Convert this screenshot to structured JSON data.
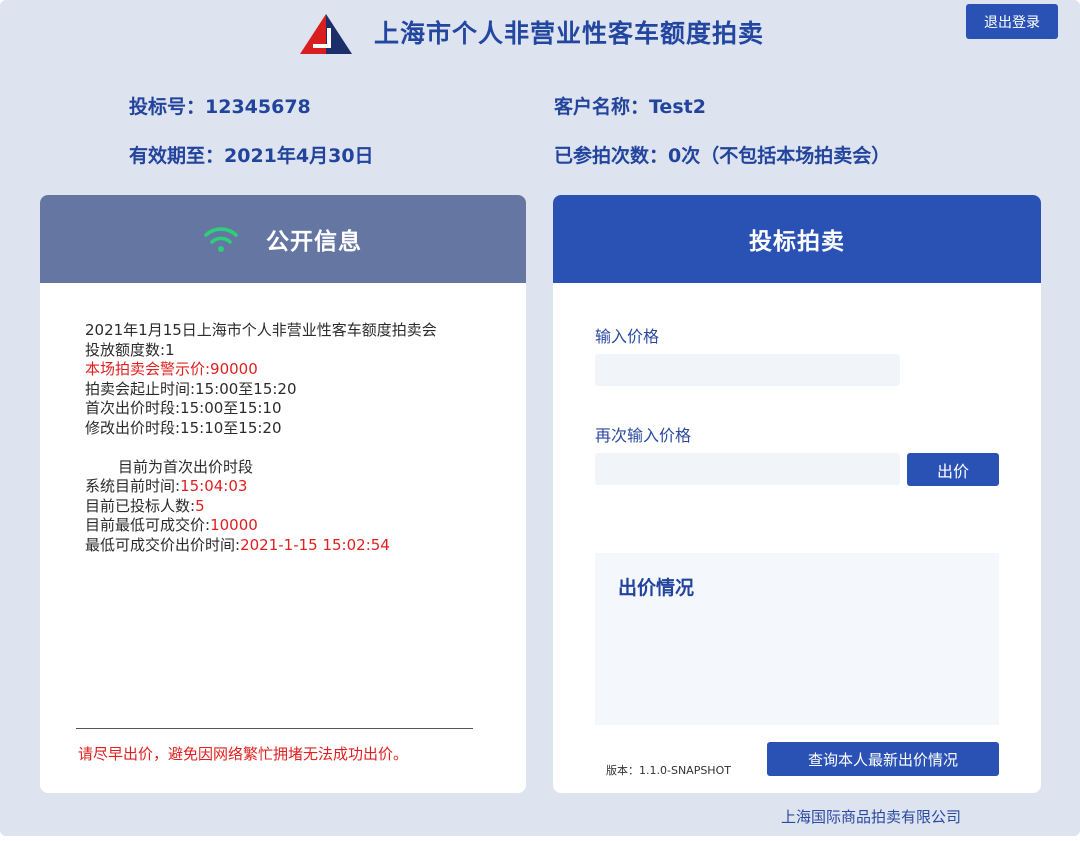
{
  "header": {
    "title": "上海市个人非营业性客车额度拍卖",
    "logout_label": "退出登录"
  },
  "bidder": {
    "bid_number": "投标号：12345678",
    "customer_name": "客户名称：Test2",
    "valid_until": "有效期至：2021年4月30日",
    "participation_count": "已参拍次数：0次（不包括本场拍卖会）"
  },
  "public_info": {
    "title": "公开信息",
    "auction_name": "2021年1月15日上海市个人非营业性客车额度拍卖会",
    "quota": "投放额度数:1",
    "warning_price": "本场拍卖会警示价:90000",
    "auction_time": "拍卖会起止时间:15:00至15:20",
    "first_bid_period": "首次出价时段:15:00至15:10",
    "modify_bid_period": "修改出价时段:15:10至15:20",
    "current_phase": "目前为首次出价时段",
    "system_time_label": "系统目前时间:",
    "system_time_value": "15:04:03",
    "bidder_count_label": "目前已投标人数:",
    "bidder_count_value": "5",
    "lowest_price_label": "目前最低可成交价:",
    "lowest_price_value": "10000",
    "lowest_price_time_label": "最低可成交价出价时间:",
    "lowest_price_time_value": "2021-1-15 15:02:54",
    "notice": "请尽早出价，避免因网络繁忙拥堵无法成功出价。"
  },
  "bidding": {
    "title": "投标拍卖",
    "price_label": "输入价格",
    "price_value": "",
    "confirm_price_label": "再次输入价格",
    "confirm_price_value": "",
    "bid_button": "出价",
    "status_title": "出价情况",
    "version": "版本：1.1.0-SNAPSHOT",
    "query_button": "查询本人最新出价情况"
  },
  "footer": {
    "company": "上海国际商品拍卖有限公司"
  },
  "colors": {
    "page_background": "#dde3ef",
    "primary_blue": "#2a52b4",
    "left_header": "#6576a3",
    "highlight_red": "#e02020",
    "wifi_green": "#2ecf7a"
  },
  "icons": {
    "logo": "auction-logo-icon",
    "public_info": "wifi-icon"
  }
}
